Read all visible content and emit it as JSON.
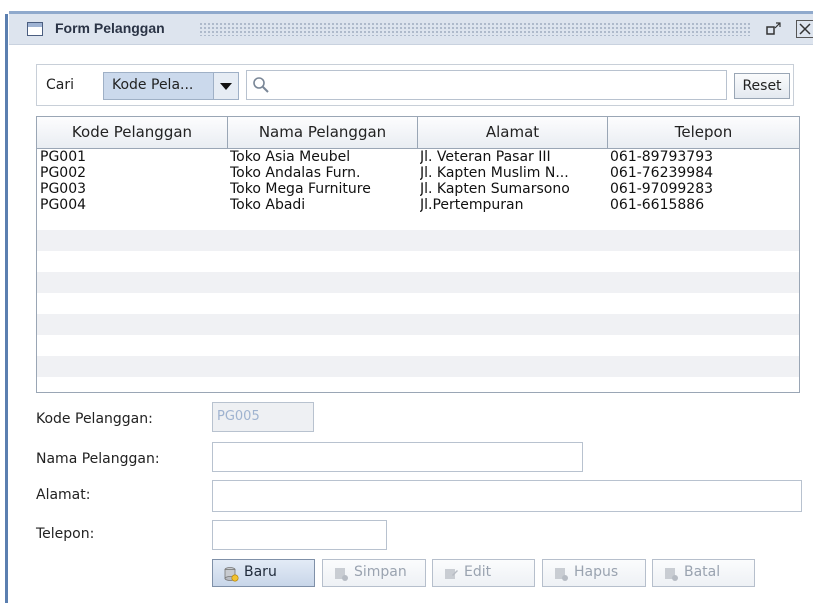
{
  "window": {
    "title": "Form Pelanggan",
    "icon": "window-icon"
  },
  "search": {
    "label": "Cari",
    "combo_value": "Kode Pela...",
    "input_value": "",
    "reset_label": "Reset"
  },
  "table": {
    "headers": [
      "Kode Pelanggan",
      "Nama Pelanggan",
      "Alamat",
      "Telepon"
    ],
    "rows": [
      [
        "PG001",
        "Toko Asia Meubel",
        "Jl. Veteran Pasar III",
        "061-89793793"
      ],
      [
        "PG002",
        "Toko Andalas Furn.",
        "Jl. Kapten Muslim N...",
        "061-76239984"
      ],
      [
        "PG003",
        "Toko Mega Furniture",
        "Jl. Kapten Sumarsono",
        "061-97099283"
      ],
      [
        "PG004",
        "Toko Abadi",
        "Jl.Pertempuran",
        "061-6615886"
      ]
    ]
  },
  "form": {
    "kode_label": "Kode Pelanggan:",
    "kode_value": "PG005",
    "nama_label": "Nama Pelanggan:",
    "nama_value": "",
    "alamat_label": "Alamat:",
    "alamat_value": "",
    "telepon_label": "Telepon:",
    "telepon_value": ""
  },
  "buttons": {
    "baru": "Baru",
    "simpan": "Simpan",
    "edit": "Edit",
    "hapus": "Hapus",
    "batal": "Batal"
  },
  "colors": {
    "accent": "#cbd9ec",
    "titlebar": "#dde4ee",
    "row_alt": "#f0f1f4"
  }
}
